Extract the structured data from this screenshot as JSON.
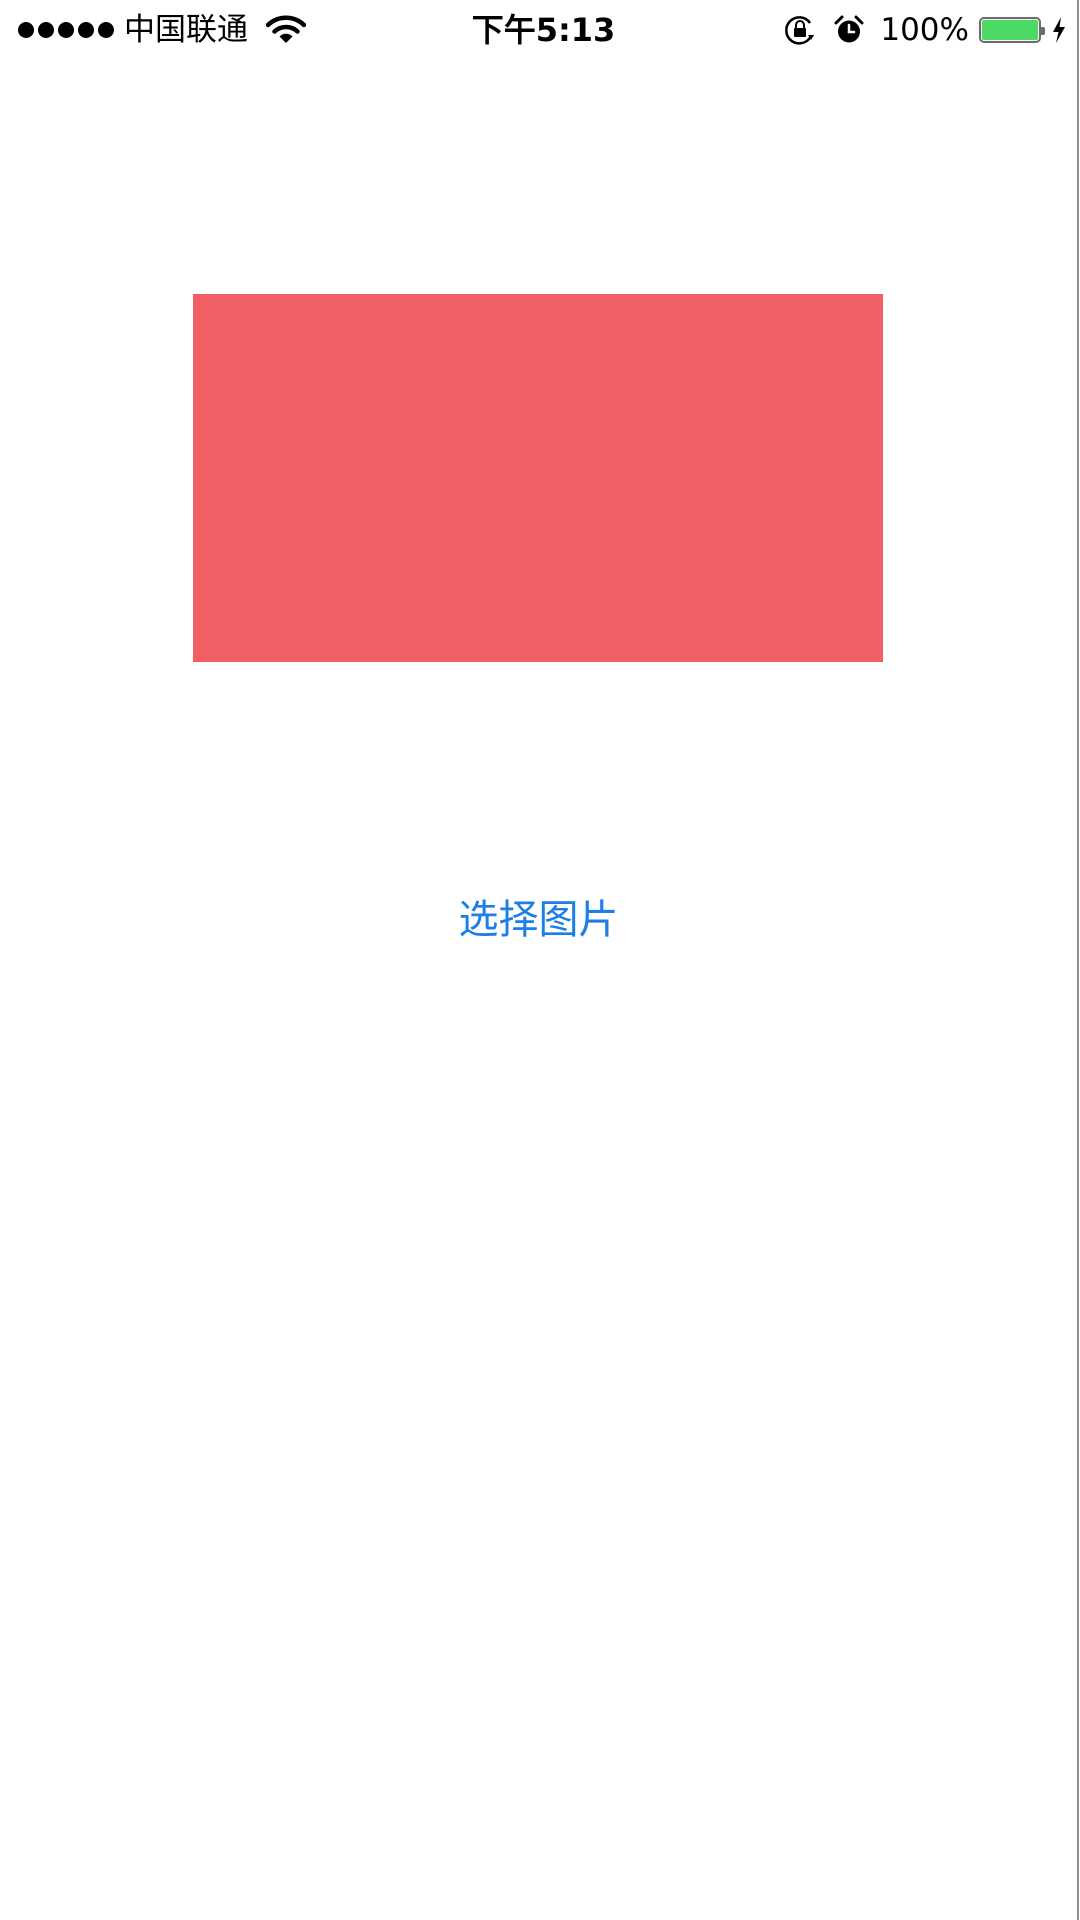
{
  "status_bar": {
    "signal_icon": "signal-dots-icon",
    "carrier": "中国联通",
    "wifi_icon": "wifi-icon",
    "time": "下午5:13",
    "rotation_lock_icon": "rotation-lock-icon",
    "alarm_icon": "alarm-icon",
    "battery_percent": "100%",
    "battery_level": 1.0,
    "battery_color": "#4cd964",
    "charging_icon": "charging-bolt-icon"
  },
  "main": {
    "image_color": "#ef5f63",
    "select_button_label": "选择图片",
    "select_button_color": "#1c7ee6"
  }
}
